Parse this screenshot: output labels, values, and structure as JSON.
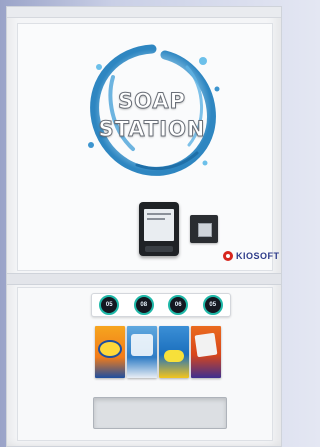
{
  "branding": {
    "logo_line1": "SOAP",
    "logo_line2": "STATION",
    "vendor_name": "KIOSOFT"
  },
  "dispenser": {
    "buttons": [
      {
        "label": "05"
      },
      {
        "label": "08"
      },
      {
        "label": "06"
      },
      {
        "label": "05"
      }
    ]
  },
  "colors": {
    "kiosoft_red": "#d7261e",
    "kiosoft_blue": "#2d3b8a",
    "button_ring": "#1fb8a8"
  }
}
